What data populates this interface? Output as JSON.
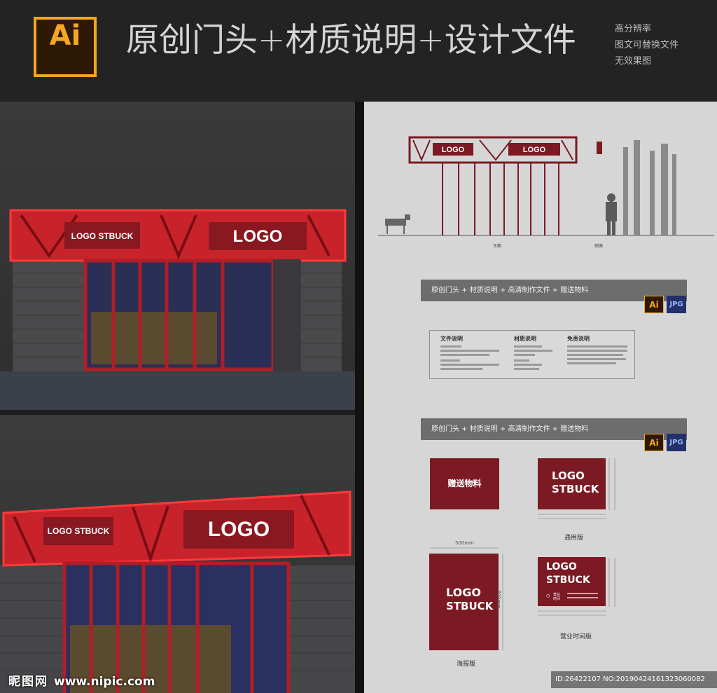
{
  "header": {
    "logo_text": "Ai",
    "title": "原创门头+材质说明+设计文件",
    "notes": [
      "高分辨率",
      "图文可替换文件",
      "无效果图"
    ]
  },
  "renders": {
    "top_sign_small": "LOGO STBUCK",
    "top_sign_large": "LOGO",
    "bottom_sign_small": "LOGO STBUCK",
    "bottom_sign_large": "LOGO"
  },
  "elevation": {
    "logo_left": "LOGO",
    "logo_right": "LOGO",
    "label_front": "正面",
    "label_side": "侧面"
  },
  "bars": {
    "bar1": "原创门头 + 材质说明 + 高清制作文件 + 赠送物料",
    "bar2": "原创门头 + 材质说明 + 高清制作文件 + 赠送物料",
    "ai_badge": "Ai",
    "jpg_badge": "JPG"
  },
  "info_box": {
    "col1_title": "文件说明",
    "col2_title": "材质说明",
    "col3_title": "免责说明"
  },
  "materials": {
    "gift": "赠送物料",
    "card_logo_line1": "LOGO",
    "card_logo_line2": "STBUCK",
    "caption_general": "通用版",
    "poster_dim_w": "500mm",
    "poster_dim_h": "700mm",
    "poster_line1": "LOGO",
    "poster_line2": "STBUCK",
    "caption_poster": "海报版",
    "hours_line1": "LOGO",
    "hours_line2": "STBUCK",
    "hours_label": "营业时间",
    "caption_hours": "营业时间版"
  },
  "watermark": {
    "site_cn": "昵图网",
    "site_url": "www.nipic.com",
    "id_text": "ID:26422107 NO:20190424161323060082"
  },
  "colors": {
    "brand_red": "#7b1a23",
    "neon_red": "#e0202a",
    "ai_orange": "#f5a623",
    "header_bg": "#232323"
  }
}
